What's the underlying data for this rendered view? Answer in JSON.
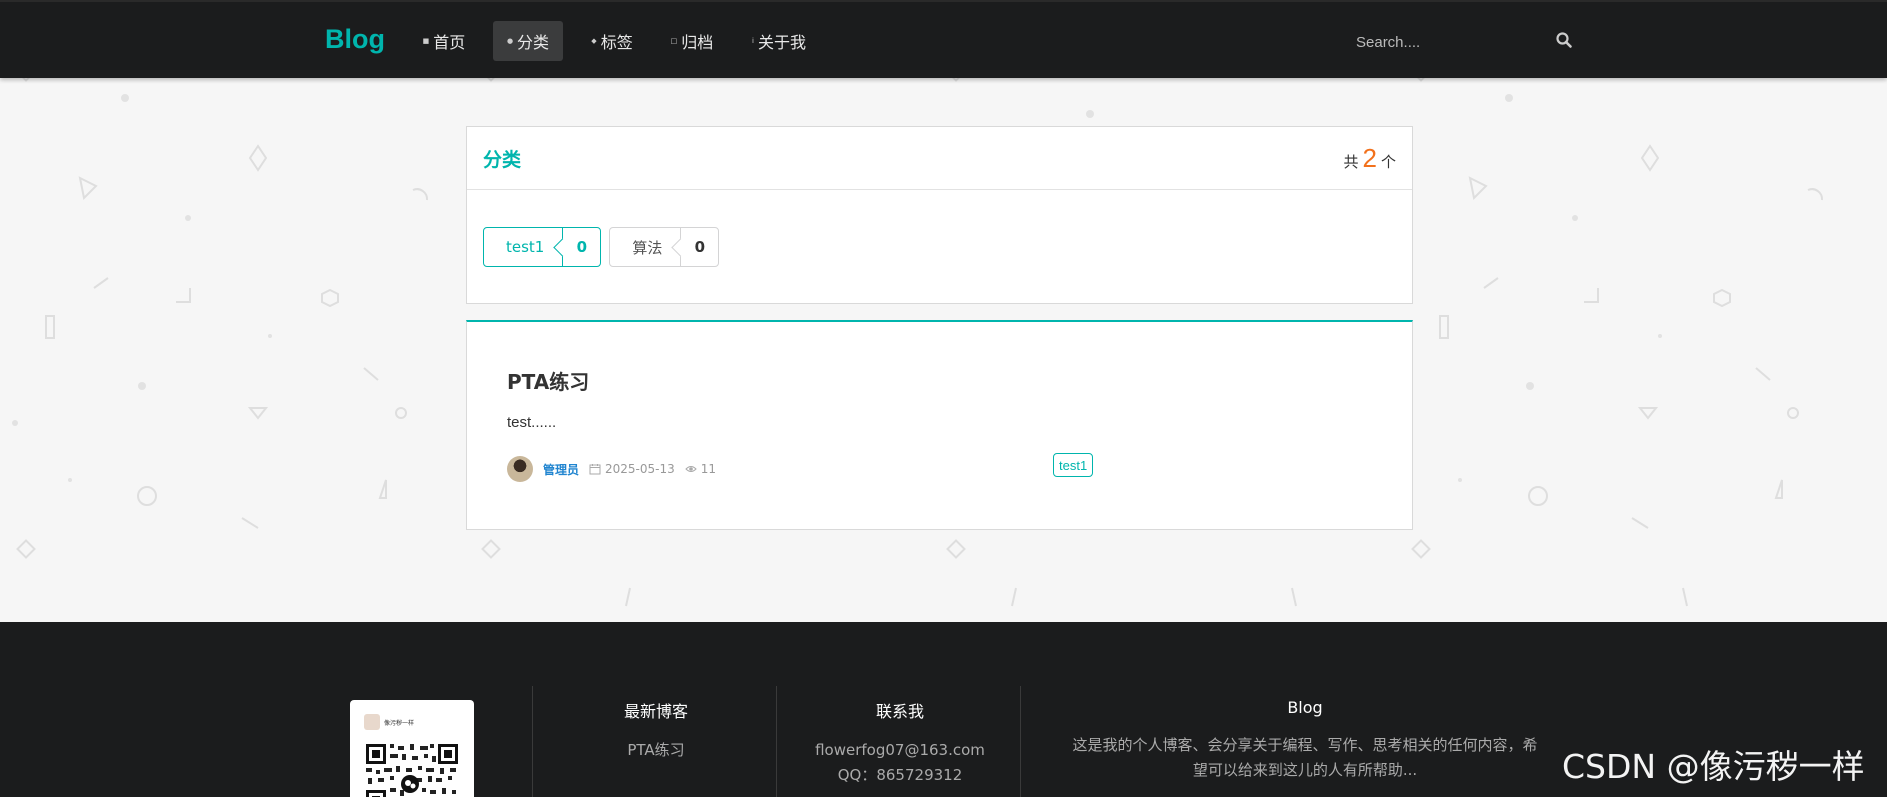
{
  "nav": {
    "logo": "Blog",
    "items": [
      {
        "label": "首页",
        "icon": "home-icon"
      },
      {
        "label": "分类",
        "icon": "idea-icon",
        "active": true
      },
      {
        "label": "标签",
        "icon": "tags-icon"
      },
      {
        "label": "归档",
        "icon": "clone-icon"
      },
      {
        "label": "关于我",
        "icon": "info-icon"
      }
    ],
    "search_placeholder": "Search...."
  },
  "categories": {
    "title": "分类",
    "count_prefix": "共",
    "count": "2",
    "count_suffix": "个",
    "items": [
      {
        "name": "test1",
        "count": "0",
        "active": true
      },
      {
        "name": "算法",
        "count": "0",
        "active": false
      }
    ]
  },
  "post": {
    "title": "PTA练习",
    "excerpt": "test......",
    "author": "管理员",
    "date": "2025-05-13",
    "views": "11",
    "tag": "test1"
  },
  "footer": {
    "qr_caption": "像污秽一样",
    "latest": {
      "heading": "最新博客",
      "items": [
        "PTA练习"
      ]
    },
    "contact": {
      "heading": "联系我",
      "email": "flowerfog07@163.com",
      "qq": "QQ：865729312"
    },
    "about": {
      "heading": "Blog",
      "line1": "这是我的个人博客、会分享关于编程、写作、思考相关的任何内容，希",
      "line2": "望可以给来到这儿的人有所帮助..."
    }
  },
  "watermark": "CSDN @像污秽一样",
  "colors": {
    "accent": "#00b5ad",
    "count": "#f2711c",
    "author": "#2185d0",
    "nav_bg": "#1b1c1d"
  }
}
